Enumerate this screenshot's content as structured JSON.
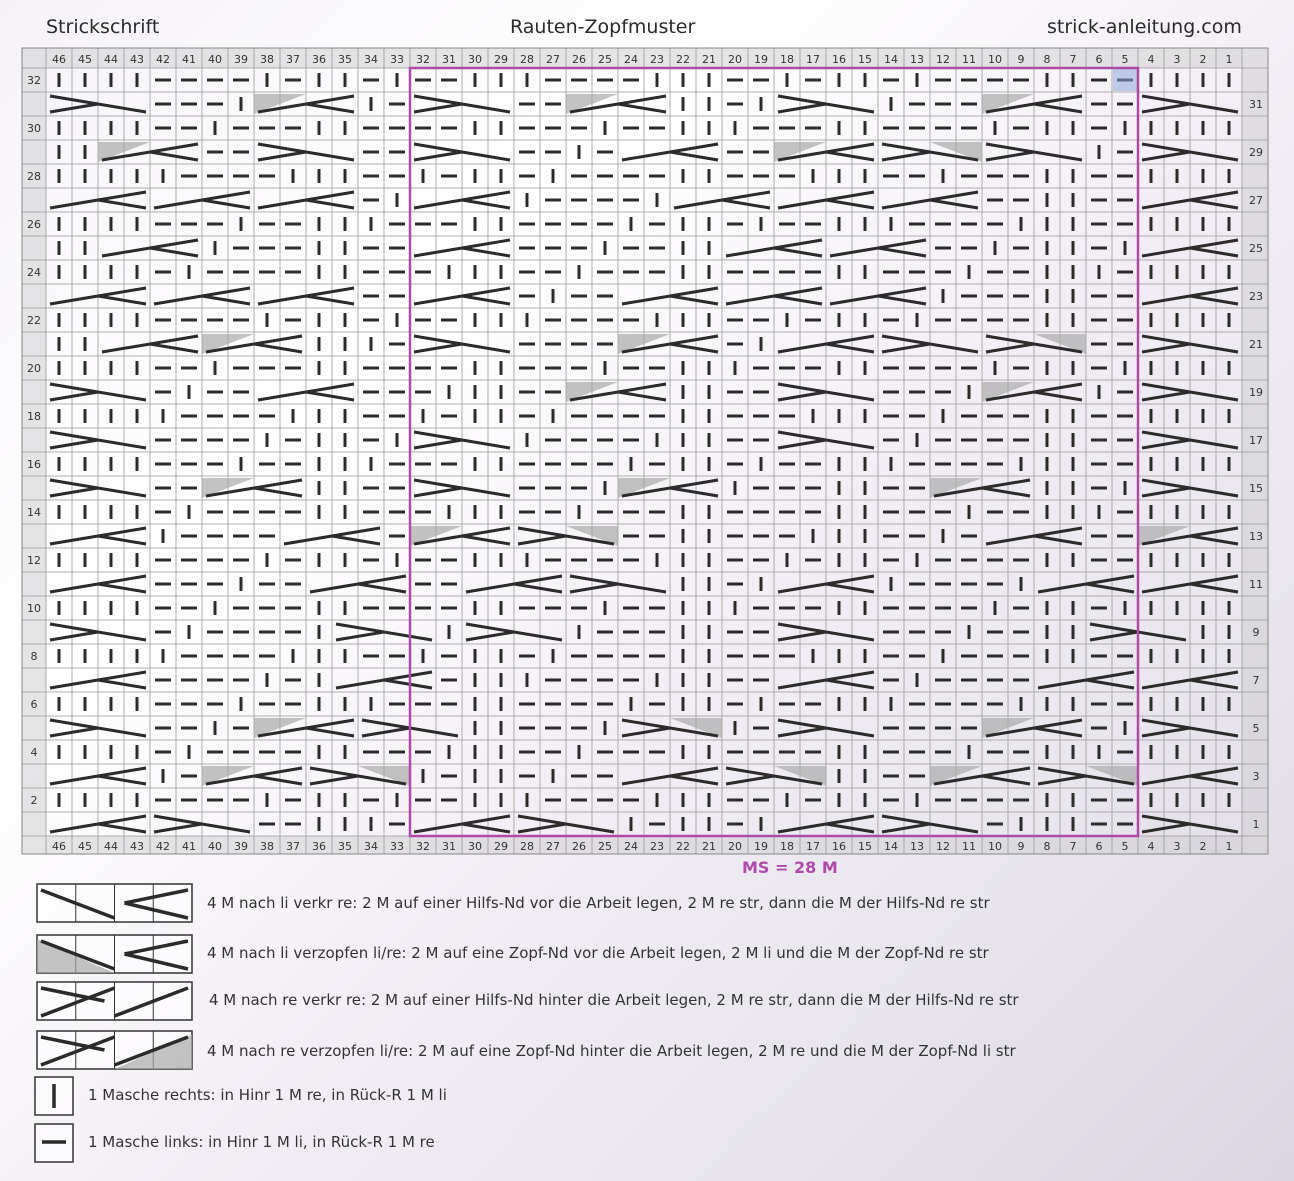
{
  "header": {
    "left": "Strickschrift",
    "center": "Rauten-Zopfmuster",
    "right": "strick-anleitung.com"
  },
  "chart": {
    "columns": 46,
    "rows": 32,
    "column_labels": [
      46,
      45,
      44,
      43,
      42,
      41,
      40,
      39,
      38,
      37,
      36,
      35,
      34,
      33,
      32,
      31,
      30,
      29,
      28,
      27,
      26,
      25,
      24,
      23,
      22,
      21,
      20,
      19,
      18,
      17,
      16,
      15,
      14,
      13,
      12,
      11,
      10,
      9,
      8,
      7,
      6,
      5,
      4,
      3,
      2,
      1
    ],
    "left_row_labels": [
      "32",
      "30",
      "28",
      "26",
      "24",
      "22",
      "20",
      "18",
      "16",
      "14",
      "12",
      "10",
      "8",
      "6",
      "4",
      "2"
    ],
    "right_row_labels": [
      "31",
      "29",
      "27",
      "25",
      "23",
      "21",
      "19",
      "17",
      "15",
      "13",
      "11",
      "9",
      "7",
      "5",
      "3",
      "1"
    ],
    "repeat_label": "MS = 28 M",
    "colors": {
      "repeat_border": "#b04aa8",
      "grid_line": "#9a9a9a",
      "header_fill": "#cfcfd2",
      "symbol": "#2b2b2b",
      "shade": "#a9a9a9"
    }
  },
  "legend": [
    {
      "icon": "cable-left-knit-icon",
      "text": "4 M nach li verkr re: 2 M auf einer Hilfs-Nd vor die Arbeit legen, 2 M re str, dann die M der Hilfs-Nd re str"
    },
    {
      "icon": "cable-left-purl-icon",
      "text": "4 M nach li verzopfen li/re: 2 M auf eine Zopf-Nd vor die Arbeit legen, 2 M li und die M der Zopf-Nd re str"
    },
    {
      "icon": "cable-right-knit-icon",
      "text": "4 M nach re verkr re: 2 M auf einer Hilfs-Nd hinter die Arbeit legen, 2 M re str, dann die M der Hilfs-Nd re str"
    },
    {
      "icon": "cable-right-purl-icon",
      "text": "4 M nach re verzopfen li/re: 2 M auf eine Zopf-Nd hinter die Arbeit legen, 2 M re und die M der Zopf-Nd li str"
    },
    {
      "icon": "knit-stitch-icon",
      "text": "1 Masche rechts: in Hinr 1 M re, in Rück-R 1 M li"
    },
    {
      "icon": "purl-stitch-icon",
      "text": "1 Masche links: in Hinr 1 M li, in Rück-R 1 M re"
    }
  ]
}
